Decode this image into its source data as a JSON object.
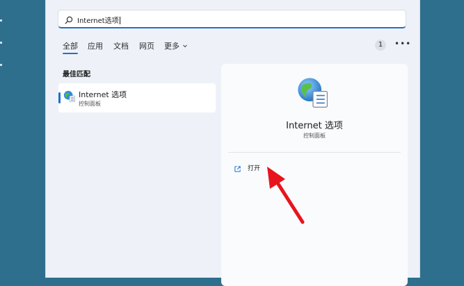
{
  "search": {
    "query": "Internet选项"
  },
  "tabs": [
    {
      "label": "全部"
    },
    {
      "label": "应用"
    },
    {
      "label": "文档"
    },
    {
      "label": "网页"
    },
    {
      "label": "更多"
    }
  ],
  "header": {
    "result_count": "1"
  },
  "best_match": {
    "label": "最佳匹配",
    "item": {
      "title": "Internet 选项",
      "subtitle": "控制面板",
      "icon": "internet-options-icon"
    }
  },
  "detail": {
    "title": "Internet 选项",
    "subtitle": "控制面板",
    "icon": "internet-options-icon",
    "actions": [
      {
        "label": "打开",
        "icon": "open-external-icon"
      }
    ]
  },
  "colors": {
    "accent": "#1f6fd0",
    "desktop": "#2e6f8e",
    "annotation_arrow": "#e8141d"
  }
}
